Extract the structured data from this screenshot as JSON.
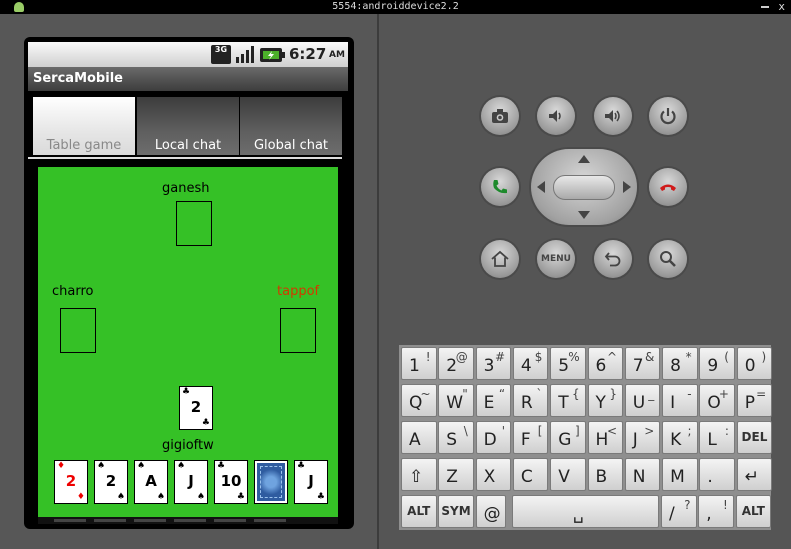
{
  "window": {
    "title": "5554:androiddevice2.2",
    "close_glyph": "x"
  },
  "status_bar": {
    "network": "3G",
    "time": "6:27",
    "ampm": "AM"
  },
  "app": {
    "title": "SercaMobile"
  },
  "tabs": [
    {
      "label": "Table game",
      "selected": true
    },
    {
      "label": "Local chat",
      "selected": false
    },
    {
      "label": "Global chat",
      "selected": false
    }
  ],
  "colors": {
    "table_green": "#35c126",
    "highlight_player": "#d23a00",
    "red_suit": "#e00000"
  },
  "table": {
    "players": {
      "top": {
        "name": "ganesh"
      },
      "left": {
        "name": "charro"
      },
      "right": {
        "name": "tappof",
        "highlighted": true
      },
      "bottom": {
        "name": "gigioftw"
      }
    },
    "played_card": {
      "rank": "2",
      "suit": "♣"
    },
    "hand": [
      {
        "rank": "2",
        "suit": "♦",
        "red": true
      },
      {
        "rank": "2",
        "suit": "♠"
      },
      {
        "rank": "A",
        "suit": "♠"
      },
      {
        "rank": "J",
        "suit": "♠"
      },
      {
        "rank": "10",
        "suit": "♣"
      },
      {
        "face_down": true
      },
      {
        "rank": "J",
        "suit": "♣"
      }
    ]
  },
  "hardware_buttons": [
    "camera-icon",
    "volume-down-icon",
    "volume-up-icon",
    "power-icon",
    "call-icon",
    "end-call-icon",
    "home-icon",
    "menu-label",
    "back-icon",
    "search-icon"
  ],
  "menu_label": "MENU",
  "keyboard": {
    "rows": [
      [
        {
          "m": "1",
          "s": "!"
        },
        {
          "m": "2",
          "s": "@"
        },
        {
          "m": "3",
          "s": "#"
        },
        {
          "m": "4",
          "s": "$"
        },
        {
          "m": "5",
          "s": "%"
        },
        {
          "m": "6",
          "s": "^"
        },
        {
          "m": "7",
          "s": "&"
        },
        {
          "m": "8",
          "s": "*"
        },
        {
          "m": "9",
          "s": "("
        },
        {
          "m": "0",
          "s": ")"
        }
      ],
      [
        {
          "m": "Q",
          "s": "~"
        },
        {
          "m": "W",
          "s": "\""
        },
        {
          "m": "E",
          "s": "“"
        },
        {
          "m": "R",
          "s": "`"
        },
        {
          "m": "T",
          "s": "{"
        },
        {
          "m": "Y",
          "s": "}"
        },
        {
          "m": "U",
          "s": "_"
        },
        {
          "m": "I",
          "s": "-"
        },
        {
          "m": "O",
          "s": "+"
        },
        {
          "m": "P",
          "s": "="
        }
      ],
      [
        {
          "m": "A",
          "s": ""
        },
        {
          "m": "S",
          "s": "\\"
        },
        {
          "m": "D",
          "s": "'"
        },
        {
          "m": "F",
          "s": "["
        },
        {
          "m": "G",
          "s": "]"
        },
        {
          "m": "H",
          "s": "<"
        },
        {
          "m": "J",
          "s": ">"
        },
        {
          "m": "K",
          "s": ";"
        },
        {
          "m": "L",
          "s": ":"
        },
        {
          "m": "",
          "s": "",
          "c": "DEL"
        }
      ],
      [
        {
          "m": "⇧",
          "s": ""
        },
        {
          "m": "Z",
          "s": ""
        },
        {
          "m": "X",
          "s": ""
        },
        {
          "m": "C",
          "s": ""
        },
        {
          "m": "V",
          "s": ""
        },
        {
          "m": "B",
          "s": ""
        },
        {
          "m": "N",
          "s": ""
        },
        {
          "m": "M",
          "s": ""
        },
        {
          "m": ".",
          "s": ""
        },
        {
          "m": "↵",
          "s": ""
        }
      ]
    ],
    "bottom_row": {
      "alt": "ALT",
      "sym": "SYM",
      "at": "@",
      "space": "␣",
      "slash": "/",
      "slash_alt": "?",
      "comma": ",",
      "comma_alt": "!",
      "alt_right": "ALT"
    }
  }
}
